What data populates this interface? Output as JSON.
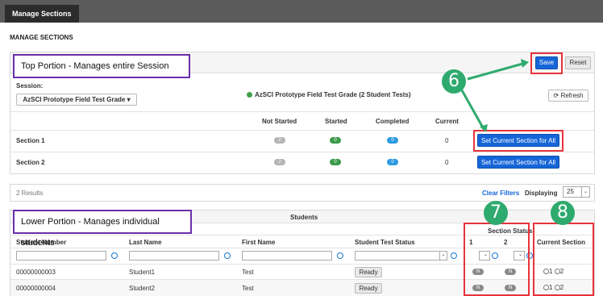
{
  "topbar": {
    "tab_label": "Manage Sections"
  },
  "page": {
    "title": "MANAGE SECTIONS"
  },
  "top_callout": "Top Portion - Manages entire Session",
  "toolbar": {
    "save_label": "Save",
    "reset_label": "Reset"
  },
  "session": {
    "label": "Session:",
    "selected": "AzSCI Prototype Field Test Grade ▾",
    "info": "AzSCI Prototype Field Test Grade (2 Student Tests)",
    "refresh_label": "Refresh"
  },
  "section_table": {
    "headers": [
      "Not Started",
      "Started",
      "Completed",
      "Current"
    ],
    "rows": [
      {
        "name": "Section 1",
        "not_started": "2",
        "started": "0",
        "completed": "0",
        "current": "0",
        "action": "Set Current Section for All"
      },
      {
        "name": "Section 2",
        "not_started": "2",
        "started": "0",
        "completed": "0",
        "current": "0",
        "action": "Set Current Section for All"
      }
    ]
  },
  "results": {
    "count": "2 Results",
    "clear_filters": "Clear Filters",
    "displaying_label": "Displaying",
    "displaying_value": "25"
  },
  "bottom_callout": "Lower Portion - Manages individual students",
  "students_table": {
    "group_header": "Students",
    "section_status_header": "Section Status",
    "headers": [
      "Student Number",
      "Last Name",
      "First Name",
      "Student Test Status",
      "1",
      "2",
      "Current Section"
    ],
    "rows": [
      {
        "number": "00000000003",
        "last": "Student1",
        "first": "Test",
        "status": "Ready",
        "s1": "N",
        "s2": "N",
        "r1": "1",
        "r2": "2"
      },
      {
        "number": "00000000004",
        "last": "Student2",
        "first": "Test",
        "status": "Ready",
        "s1": "N",
        "s2": "N",
        "r1": "1",
        "r2": "2"
      }
    ]
  },
  "annotations": {
    "n6": "6",
    "n7": "7",
    "n8": "8"
  },
  "colors": {
    "accent": "#1565d8",
    "highlight": "#e8333b",
    "callout_border": "#6a2fa8",
    "marker": "#2eaa6e"
  }
}
